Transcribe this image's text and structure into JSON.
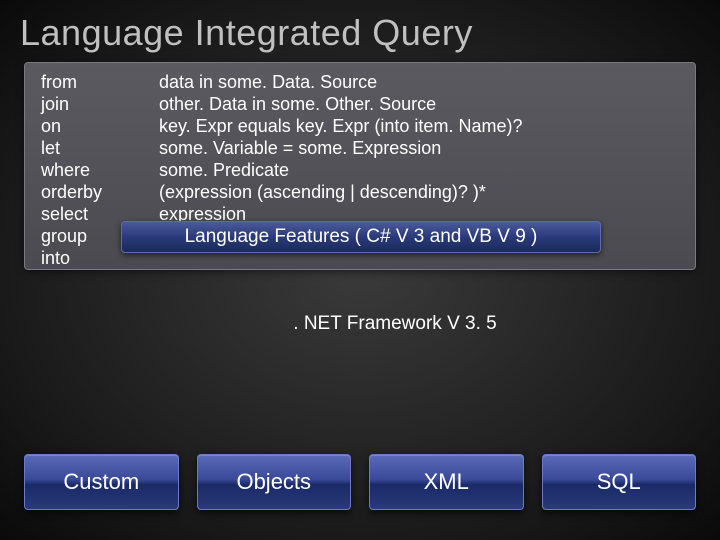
{
  "title": "Language Integrated Query",
  "code": [
    {
      "kw": "from",
      "expr": "data in some. Data. Source"
    },
    {
      "kw": "join",
      "expr": "other. Data in some. Other. Source"
    },
    {
      "kw": "on",
      "expr": "key. Expr equals key. Expr (into item. Name)?"
    },
    {
      "kw": "let",
      "expr": "some. Variable = some. Expression"
    },
    {
      "kw": "where",
      "expr": "some. Predicate"
    },
    {
      "kw": "orderby",
      "expr": "(expression (ascending | descending)? )*"
    },
    {
      "kw": "select",
      "expr": "expression"
    },
    {
      "kw": "group",
      "expr": ""
    },
    {
      "kw": "into",
      "expr": ""
    }
  ],
  "lang_bar": "Language Features ( C# V 3 and VB V 9 )",
  "fw_bar": ". NET Framework V 3. 5",
  "pills": [
    "Custom",
    "Objects",
    "XML",
    "SQL"
  ]
}
